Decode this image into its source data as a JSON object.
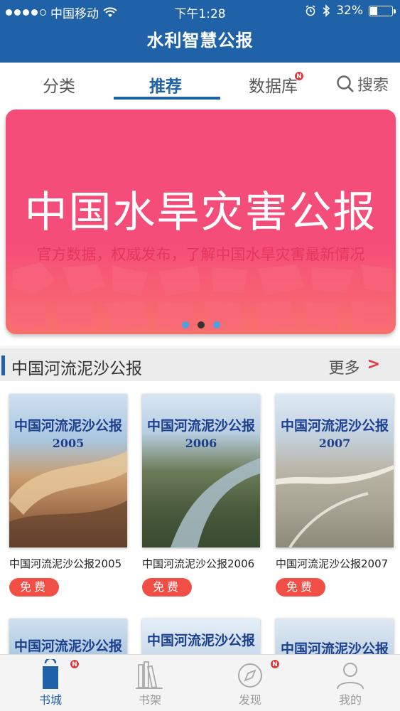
{
  "status": {
    "carrier": "中国移动",
    "time": "下午1:28",
    "battery": "32%",
    "battery_level": 0.32
  },
  "header": {
    "title": "水利智慧公报"
  },
  "tabs": [
    {
      "label": "分类"
    },
    {
      "label": "推荐"
    },
    {
      "label": "数据库",
      "badge": "N"
    },
    {
      "label": "搜索",
      "icon": "search-icon"
    }
  ],
  "banner": {
    "title": "中国水旱灾害公报",
    "subtitle": "官方数据，权威发布，了解中国水旱灾害最新情况",
    "pages": 3,
    "active_page": 2
  },
  "section": {
    "title": "中国河流泥沙公报",
    "more": "更多",
    "more_arrow": ">"
  },
  "books": [
    {
      "title": "中国河流泥沙公报2005",
      "cover_title": "中国河流泥沙公报",
      "cover_year": "2005",
      "price": "免费"
    },
    {
      "title": "中国河流泥沙公报2006",
      "cover_title": "中国河流泥沙公报",
      "cover_year": "2006",
      "price": "免费"
    },
    {
      "title": "中国河流泥沙公报2007",
      "cover_title": "中国河流泥沙公报",
      "cover_year": "2007",
      "price": "免费"
    }
  ],
  "books_row2": [
    {
      "cover_title": "中国河流泥沙公报"
    },
    {
      "cover_title": "中国河流泥沙公报"
    },
    {
      "cover_title": "中国河流泥沙公报"
    }
  ],
  "tabbar": [
    {
      "label": "书城",
      "icon": "shopping-bag-icon",
      "badge": "N",
      "active": true
    },
    {
      "label": "书架",
      "icon": "bookshelf-icon"
    },
    {
      "label": "发现",
      "icon": "compass-icon",
      "badge": "N"
    },
    {
      "label": "我的",
      "icon": "user-icon"
    }
  ],
  "colors": {
    "primary": "#1f62a8",
    "banner": "#f54d7a",
    "accent_red": "#f14f45"
  }
}
